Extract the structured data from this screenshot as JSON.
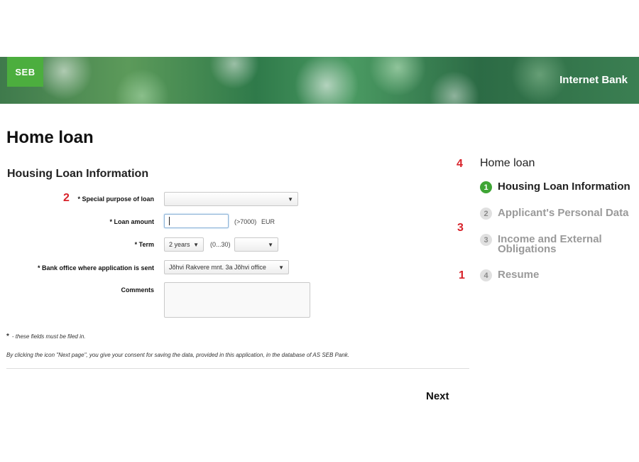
{
  "header": {
    "logo_text": "SEB",
    "bank_title": "Internet Bank"
  },
  "page": {
    "title": "Home loan",
    "section_title": "Housing Loan Information"
  },
  "form": {
    "purpose_label": "* Special purpose of loan",
    "purpose_value": "",
    "amount_label": "* Loan amount",
    "amount_value": "",
    "amount_hint": "(>7000)",
    "amount_currency": "EUR",
    "term_label": "* Term",
    "term_years": "2 years",
    "term_hint": "(0...30)",
    "term_extra_value": "",
    "office_label": "* Bank office where application is sent",
    "office_value": "Jõhvi Rakvere mnt. 3a Jõhvi office",
    "comments_label": "Comments",
    "comments_value": ""
  },
  "notes": {
    "required_star": "*",
    "required_text": "- these fields must be filed in.",
    "consent_text": "By clicking the icon \"Next page\", you give your consent for saving the data, provided in this application, in the database of AS SEB Pank."
  },
  "actions": {
    "next_label": "Next"
  },
  "steps_panel": {
    "title": "Home loan",
    "steps": [
      {
        "number": "1",
        "label": "Housing Loan Information",
        "state": "active"
      },
      {
        "number": "2",
        "label": "Applicant's Personal Data",
        "state": "inactive"
      },
      {
        "number": "3",
        "label": "Income and External Obligations",
        "state": "inactive"
      },
      {
        "number": "4",
        "label": "Resume",
        "state": "inactive"
      }
    ]
  },
  "annotations": {
    "marker_1": "1",
    "marker_2": "2",
    "marker_3": "3",
    "marker_4": "4"
  },
  "colors": {
    "brand_green": "#4cae3e",
    "active_step": "#3fa535",
    "marker_red": "#d8222a"
  }
}
